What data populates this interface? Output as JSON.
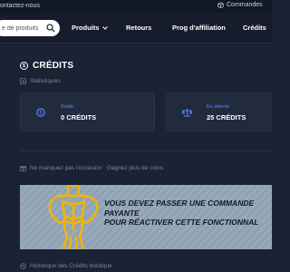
{
  "topbar": {
    "contact_label": "ontactez-nous",
    "orders_label": "Commandes",
    "orders_icon": "box-icon"
  },
  "nav": {
    "search_placeholder": "e de produits",
    "items": [
      {
        "label": "Produits",
        "has_dropdown": true
      },
      {
        "label": "Retours"
      },
      {
        "label": "Prog d'affiliation"
      },
      {
        "label": "Crédits"
      }
    ]
  },
  "credits": {
    "title": "CRÉDITS",
    "stats_heading": "Statistiques",
    "cards": [
      {
        "label": "Solde",
        "value": "0 CRÉDITS",
        "icon": "coin-icon"
      },
      {
        "label": "En attente",
        "value": "25 CRÉDITS",
        "icon": "balance-scale-icon"
      }
    ],
    "promo_heading": "Ne manquez pas l'occasion : Gagnez plus de coins",
    "promo_message": {
      "line1": "VOUS DEVEZ PASSER UNE COMMANDE",
      "line2": "PAYANTE",
      "line3": "POUR RÉACTIVER CETTE FONCTIONNAL"
    },
    "history_heading": "Historique des Crédits boutique"
  },
  "colors": {
    "background": "#1b2233",
    "card": "#222a3d",
    "accent": "#4f8bff",
    "banner": "#8fa2b3",
    "mascot": "#f2b400"
  }
}
